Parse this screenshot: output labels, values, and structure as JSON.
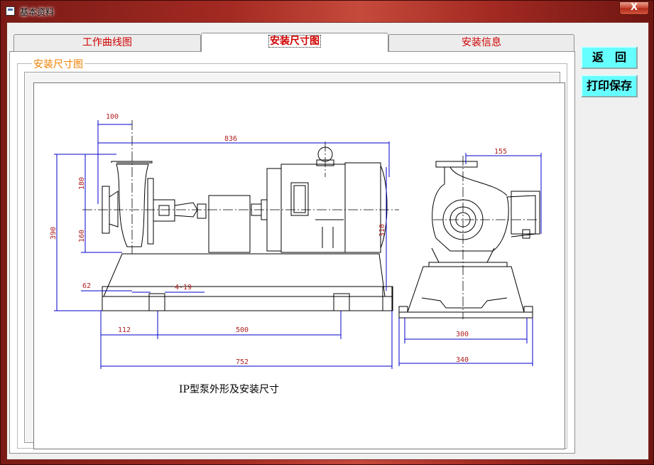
{
  "window": {
    "title": "基本资料",
    "close_label": "X"
  },
  "tabs": [
    {
      "label": "工作曲线图",
      "active": false
    },
    {
      "label": "安装尺寸图",
      "active": true
    },
    {
      "label": "安装信息",
      "active": false
    }
  ],
  "group": {
    "label": "安装尺寸图"
  },
  "buttons": {
    "back_label": "返　回",
    "print_save_label": "打印保存"
  },
  "drawing": {
    "caption": "IP型泵外形及安装尺寸",
    "dimensions": {
      "d100": "100",
      "d836": "836",
      "d180": "180",
      "d160": "160",
      "d390": "390",
      "d310": "310",
      "d62": "62",
      "d4_19": "4-19",
      "d112": "112",
      "d500": "500",
      "d752": "752",
      "d155": "155",
      "d300": "300",
      "d340": "340"
    }
  },
  "colors": {
    "tab_text": "#d00000",
    "group_label": "#f08000",
    "button_bg": "#66ffff",
    "dimension_line": "#0000cc",
    "dimension_text": "#b02020"
  }
}
